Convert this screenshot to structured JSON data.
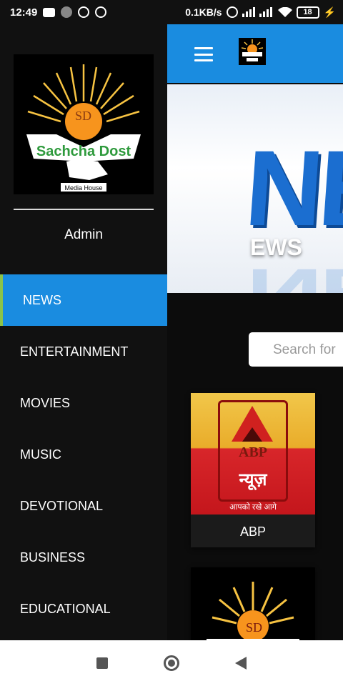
{
  "status_bar": {
    "time": "12:49",
    "net_speed": "0.1KB/s",
    "battery": "18"
  },
  "app_bar": {
    "menu_icon": "hamburger-icon",
    "logo_icon": "sachcha-dost-logo"
  },
  "banner": {
    "big_text": "NE",
    "title": "EWS"
  },
  "search": {
    "placeholder": "Search for"
  },
  "cards": [
    {
      "logo_text": "ABP",
      "logo_hindi": "न्यूज़",
      "logo_tagline": "आपको रखे आगे",
      "label": "ABP"
    },
    {
      "label": ""
    }
  ],
  "drawer": {
    "logo": {
      "initials": "SD",
      "brand": "Sachcha Dost",
      "sub": "Media House"
    },
    "user": "Admin",
    "menu": [
      {
        "label": "NEWS",
        "active": true
      },
      {
        "label": "ENTERTAINMENT"
      },
      {
        "label": "MOVIES"
      },
      {
        "label": "MUSIC"
      },
      {
        "label": "DEVOTIONAL"
      },
      {
        "label": "BUSINESS"
      },
      {
        "label": "EDUCATIONAL"
      }
    ]
  },
  "colors": {
    "accent": "#1a8ce0",
    "active_marker": "#8bc34a",
    "drawer_bg": "#111111"
  }
}
